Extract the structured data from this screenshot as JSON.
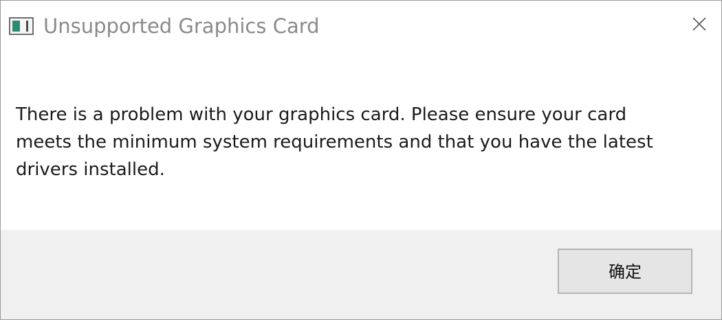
{
  "window": {
    "title": "Unsupported Graphics Card",
    "icon": "application-window-icon",
    "close_icon": "close-icon"
  },
  "dialog": {
    "message": "There is a problem with your graphics card. Please ensure your card meets the minimum system requirements and that you have the latest drivers installed."
  },
  "footer": {
    "ok_label": "确定"
  },
  "colors": {
    "title_text": "#8a8a8a",
    "message_text": "#1a1a1a",
    "footer_background": "#f0f0f0",
    "button_background": "#e5e5e5",
    "button_border": "#b4b4b4",
    "icon_accent": "#2e8b73"
  }
}
